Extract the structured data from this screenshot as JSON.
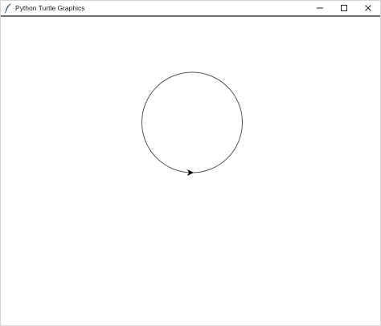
{
  "window": {
    "title": "Python Turtle Graphics",
    "icon": "feather-icon",
    "controls": {
      "minimize_icon": "minimize-icon",
      "maximize_icon": "maximize-icon",
      "close_icon": "close-icon"
    }
  },
  "canvas": {
    "background": "#ffffff",
    "stroke_color": "#555555",
    "turtle_shape": "arrow",
    "turtle_heading": "east",
    "turtle_color": "#000000",
    "drawing": "circle"
  }
}
